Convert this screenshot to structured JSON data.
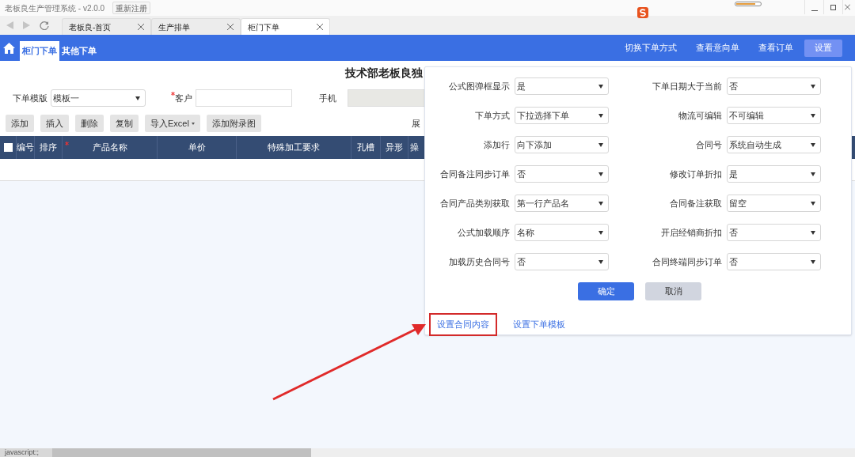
{
  "window": {
    "title": "老板良生产管理系统 - v2.0.0",
    "register_button": "重新注册"
  },
  "browser_tabs": [
    {
      "label": "老板良-首页",
      "selected": false
    },
    {
      "label": "生产排单",
      "selected": false
    },
    {
      "label": "柜门下单",
      "selected": true
    }
  ],
  "nav": {
    "items": [
      {
        "label": "柜门下单",
        "selected": true
      },
      {
        "label": "其他下单",
        "selected": false
      }
    ],
    "actions": [
      {
        "label": "切换下单方式",
        "selected": false
      },
      {
        "label": "查看意向单",
        "selected": false
      },
      {
        "label": "查看订单",
        "selected": false
      },
      {
        "label": "设置",
        "selected": true
      }
    ]
  },
  "page": {
    "title": "技术部老板良独",
    "form": [
      {
        "kind": "select",
        "label": "下单模版",
        "value": "模板一",
        "required": false,
        "disabled": false
      },
      {
        "kind": "input",
        "label": "客户",
        "required": true,
        "disabled": false
      },
      {
        "kind": "input",
        "label": "手机",
        "required": false,
        "disabled": true
      }
    ],
    "toolbar": [
      {
        "label": "添加",
        "has_menu": false
      },
      {
        "label": "插入",
        "has_menu": false
      },
      {
        "label": "删除",
        "has_menu": false
      },
      {
        "label": "复制",
        "has_menu": false
      },
      {
        "label": "导入Excel",
        "has_menu": true
      },
      {
        "label": "添加附录图",
        "has_menu": false
      }
    ],
    "expand_label": "展",
    "table": {
      "select_all_checked": false,
      "columns": [
        {
          "label": "编号",
          "required": false
        },
        {
          "label": "排序",
          "required": false
        },
        {
          "label": "产品名称",
          "required": true
        },
        {
          "label": "单价",
          "required": false
        },
        {
          "label": "特殊加工要求",
          "required": false
        },
        {
          "label": "孔槽",
          "required": false
        },
        {
          "label": "异形",
          "required": false
        },
        {
          "label": "操",
          "required": false
        }
      ]
    }
  },
  "settings_popup": {
    "fields": [
      {
        "label": "公式图弹框显示",
        "value": "是"
      },
      {
        "label": "下单日期大于当前",
        "value": "否"
      },
      {
        "label": "下单方式",
        "value": "下拉选择下单"
      },
      {
        "label": "物流可编辑",
        "value": "不可编辑"
      },
      {
        "label": "添加行",
        "value": "向下添加"
      },
      {
        "label": "合同号",
        "value": "系统自动生成"
      },
      {
        "label": "合同备注同步订单",
        "value": "否"
      },
      {
        "label": "修改订单折扣",
        "value": "是"
      },
      {
        "label": "合同产品类别获取",
        "value": "第一行产品名"
      },
      {
        "label": "合同备注获取",
        "value": "留空"
      },
      {
        "label": "公式加载顺序",
        "value": "名称"
      },
      {
        "label": "开启经销商折扣",
        "value": "否"
      },
      {
        "label": "加载历史合同号",
        "value": "否"
      },
      {
        "label": "合同终端同步订单",
        "value": "否"
      }
    ],
    "confirm": "确定",
    "cancel": "取消",
    "links": [
      {
        "label": "设置合同内容",
        "highlighted": true
      },
      {
        "label": "设置下单模板",
        "highlighted": false
      }
    ]
  },
  "status_bar": "javascript:;"
}
